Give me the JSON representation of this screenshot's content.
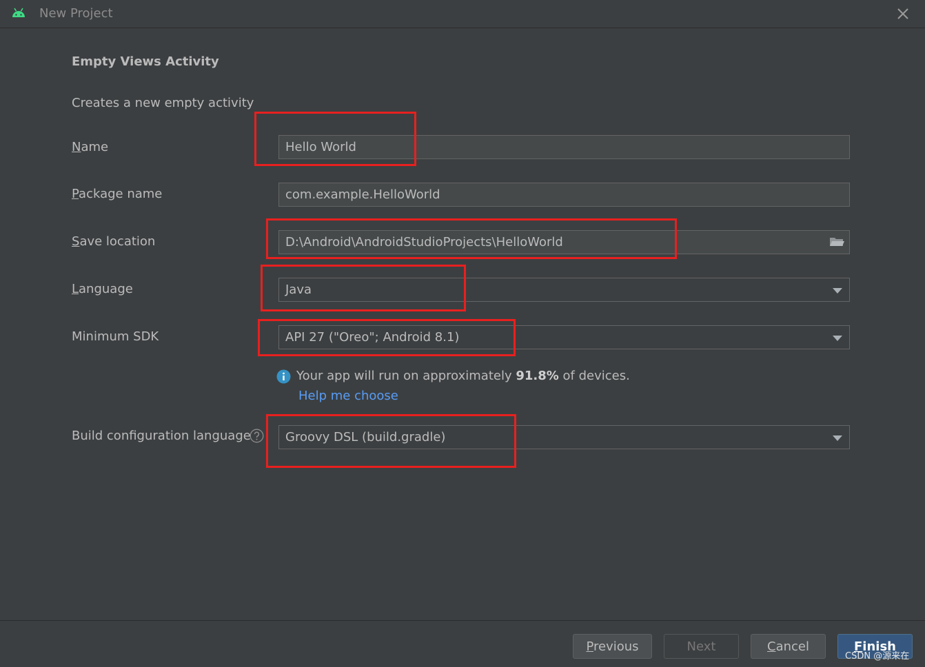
{
  "window": {
    "title": "New Project",
    "app_icon": "android-icon",
    "close_icon": "close-icon"
  },
  "template": {
    "heading": "Empty Views Activity",
    "description": "Creates a new empty activity"
  },
  "form": {
    "name": {
      "mnemonic": "N",
      "label_rest": "ame",
      "value": "Hello World"
    },
    "package_name": {
      "mnemonic": "P",
      "label_rest": "ackage name",
      "value": "com.example.HelloWorld"
    },
    "save_location": {
      "mnemonic": "S",
      "label_rest": "ave location",
      "value": "D:\\Android\\AndroidStudioProjects\\HelloWorld",
      "browse_icon": "folder-icon"
    },
    "language": {
      "mnemonic": "L",
      "label_rest": "anguage",
      "selected": "Java"
    },
    "minimum_sdk": {
      "label": "Minimum SDK",
      "selected": "API 27 (\"Oreo\"; Android 8.1)"
    },
    "info": {
      "icon": "info-icon",
      "prefix": "Your app will run on approximately ",
      "percent": "91.8%",
      "suffix": " of devices.",
      "link": "Help me choose"
    },
    "build_config": {
      "label": "Build configuration language",
      "help_icon": "question-icon",
      "selected": "Groovy DSL (build.gradle)"
    }
  },
  "buttons": {
    "previous": {
      "mnemonic": "P",
      "rest": "revious"
    },
    "next": "Next",
    "cancel": {
      "mnemonic": "C",
      "rest": "ancel"
    },
    "finish": {
      "mnemonic": "F",
      "rest": "inish"
    }
  },
  "watermark": "CSDN @源来在",
  "colors": {
    "background": "#3c3f41",
    "field_bg": "#45494a",
    "annotation_red": "#e8201f",
    "link_blue": "#589df6",
    "primary_button": "#365880",
    "android_green": "#3ddc84"
  }
}
